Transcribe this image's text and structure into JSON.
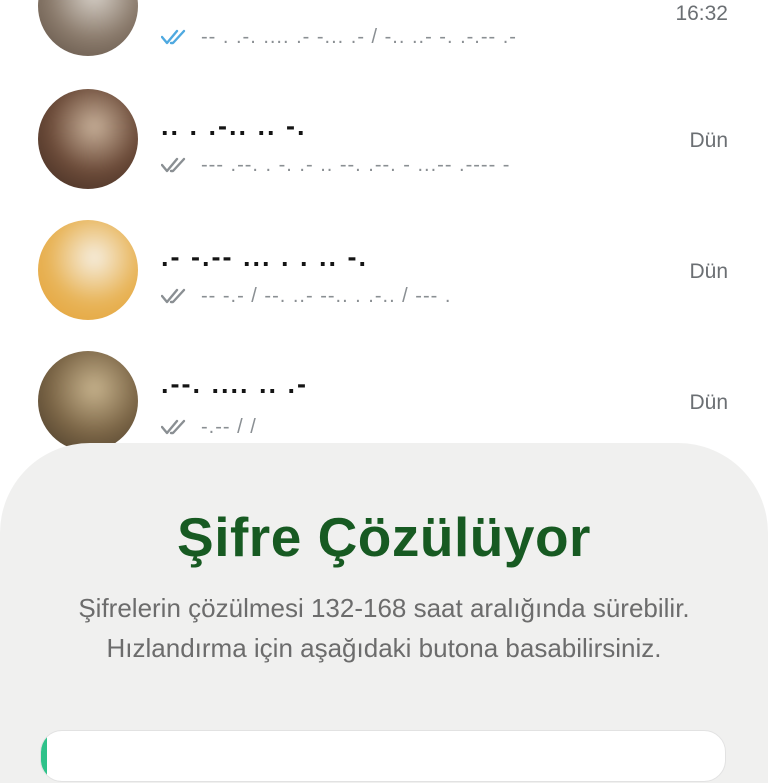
{
  "chats": [
    {
      "name": "",
      "preview": "-- . .-. .... .- -... .- / -.. ..- -. .-.-- .-",
      "time": "16:32",
      "read": true,
      "tick_color": "#4fa9e0",
      "avatar_colors": [
        "#d9d3cb",
        "#8a7a6b",
        "#4a3d33"
      ]
    },
    {
      "name": ".. . .-.. .. -.",
      "preview": "--- .--. . -. .- .. --. .--. - ...-- .---- -",
      "time": "Dün",
      "read": false,
      "tick_color": "#8a8f93",
      "avatar_colors": [
        "#c9b29b",
        "#6b4a38",
        "#2b1d17"
      ]
    },
    {
      "name": ".- -.-- ... . . .. -.",
      "preview": "-- -.- / --. ..- --.. . .-.. / --- .",
      "time": "Dün",
      "read": false,
      "tick_color": "#8a8f93",
      "avatar_colors": [
        "#f6efe2",
        "#e8b458",
        "#e39a2a"
      ]
    },
    {
      "name": ".--. .... .. .-",
      "preview": "-.-- / /",
      "time": "Dün",
      "read": false,
      "tick_color": "#8a8f93",
      "avatar_colors": [
        "#c8b48e",
        "#7a6445",
        "#2e261d"
      ]
    }
  ],
  "sheet": {
    "title": "Şifre Çözülüyor",
    "description": "Şifrelerin çözülmesi 132-168 saat aralığında sürebilir. Hızlandırma için aşağıdaki butona basabilirsiniz.",
    "accent_color": "#175a22"
  }
}
